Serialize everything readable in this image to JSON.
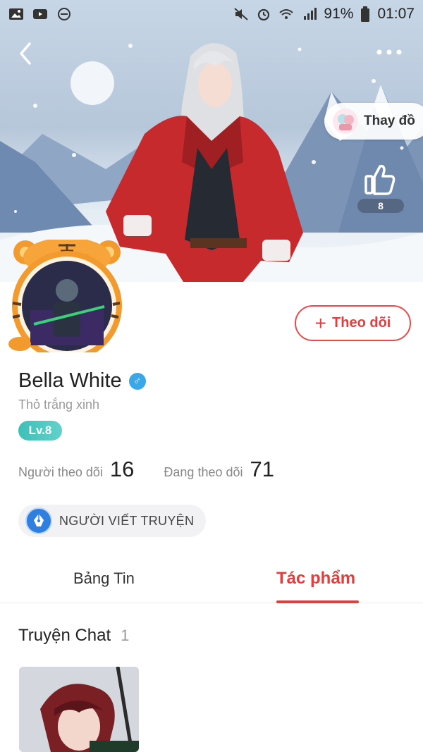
{
  "status_bar": {
    "battery_percent": "91%",
    "time": "01:07",
    "left_icons": [
      "image-icon",
      "youtube-icon",
      "do-not-disturb-icon"
    ],
    "right_icons": [
      "mute-icon",
      "alarm-icon",
      "wifi-icon",
      "signal-icon",
      "battery-icon"
    ]
  },
  "header": {
    "change_outfit_label": "Thay đồ",
    "like_count": "8"
  },
  "profile": {
    "name": "Bella White",
    "gender_symbol": "♂",
    "bio": "Thỏ trắng xinh",
    "level": "Lv.8",
    "follow_button": {
      "icon": "+",
      "label": "Theo dõi"
    },
    "followers_label": "Người theo dõi",
    "followers_count": "16",
    "following_label": "Đang theo dõi",
    "following_count": "71",
    "badge_label": "NGƯỜI VIẾT TRUYỆN"
  },
  "tabs": [
    {
      "label": "Bảng Tin",
      "active": false
    },
    {
      "label": "Tác phẩm",
      "active": true
    }
  ],
  "works": {
    "section_title": "Truyện Chat",
    "count": "1"
  },
  "colors": {
    "accent": "#e43d3d",
    "level_badge": "#3dc0b8",
    "gender_badge": "#3aa7e8",
    "writer_badge_icon": "#2f7fe0"
  }
}
